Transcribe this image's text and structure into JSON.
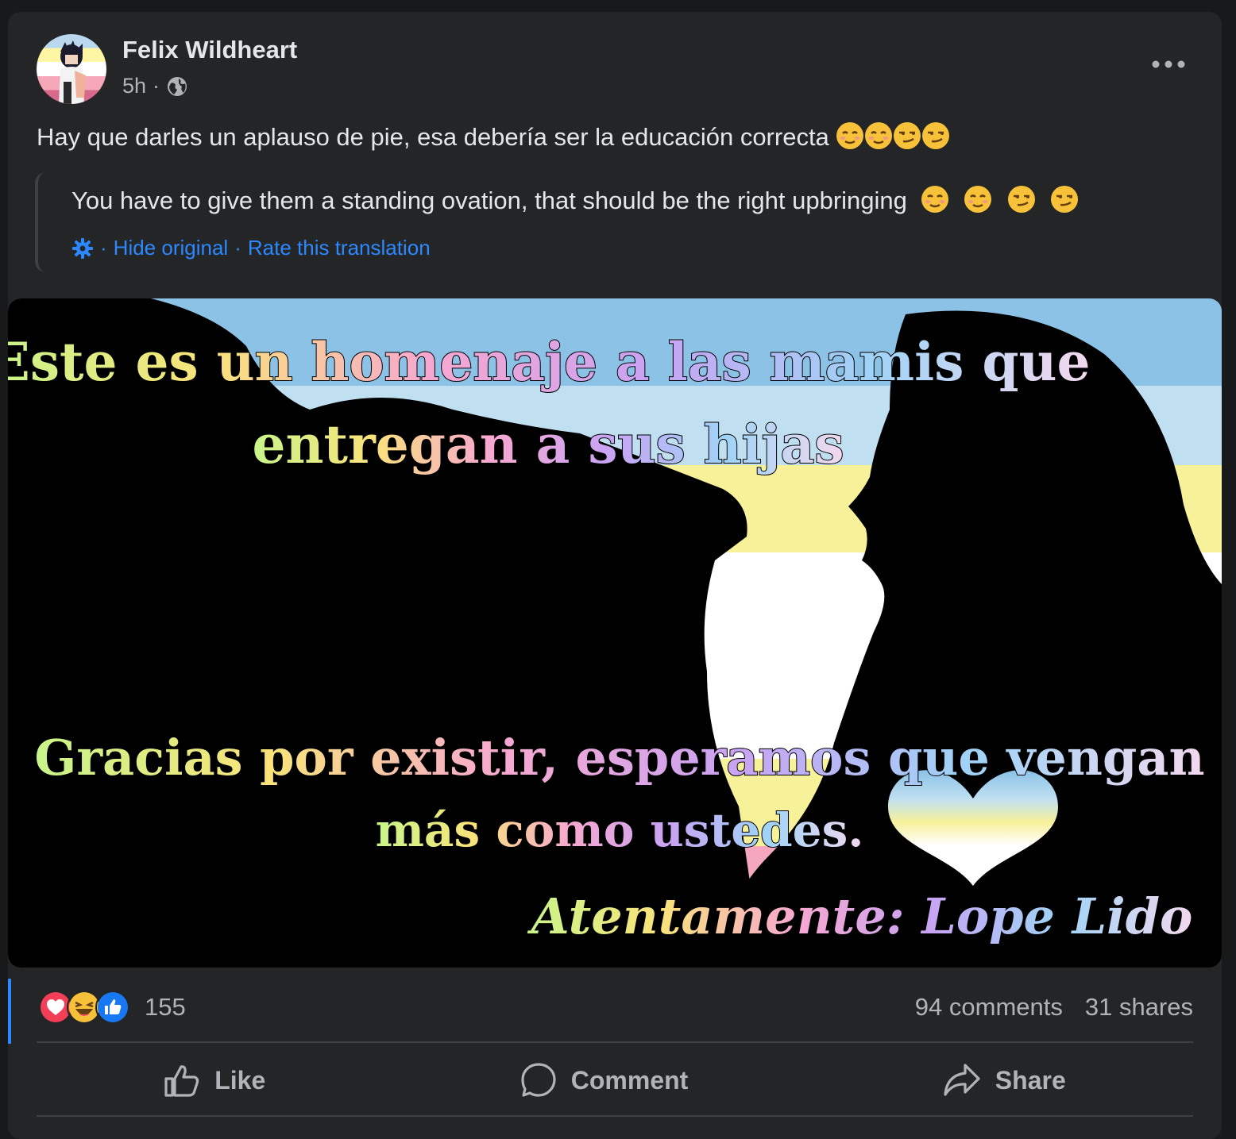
{
  "post": {
    "author": "Felix Wildheart",
    "time": "5h",
    "separator": "·",
    "visibility_icon": "globe-icon",
    "text": "Hay que darles un aplauso de pie, esa debería ser la educación correcta",
    "translation": "You have to give them a standing ovation, that should be the right upbringing",
    "hide_original": "Hide original",
    "rate_translation": "Rate this translation",
    "trans_separator": "·"
  },
  "image": {
    "line1": "Este es un homenaje a las mamis que",
    "line2": "entregan a sus hijas",
    "line3": "Gracias por existir, esperamos que vengan",
    "line4": "más como ustedes.",
    "signature": "Atentamente: Lope Lido"
  },
  "stats": {
    "reaction_icons": [
      "love-icon",
      "haha-icon",
      "like-icon"
    ],
    "reaction_count": "155",
    "comments": "94 comments",
    "shares": "31 shares"
  },
  "actions": {
    "like": "Like",
    "comment": "Comment",
    "share": "Share"
  },
  "colors": {
    "flag_blue": "#8cc2e6",
    "flag_light_blue": "#c0e0f2",
    "flag_yellow": "#f7f19a",
    "flag_white": "#ffffff",
    "flag_pink": "#f5a8bd",
    "flag_dark_pink": "#c95a82",
    "link": "#2d88ff"
  }
}
